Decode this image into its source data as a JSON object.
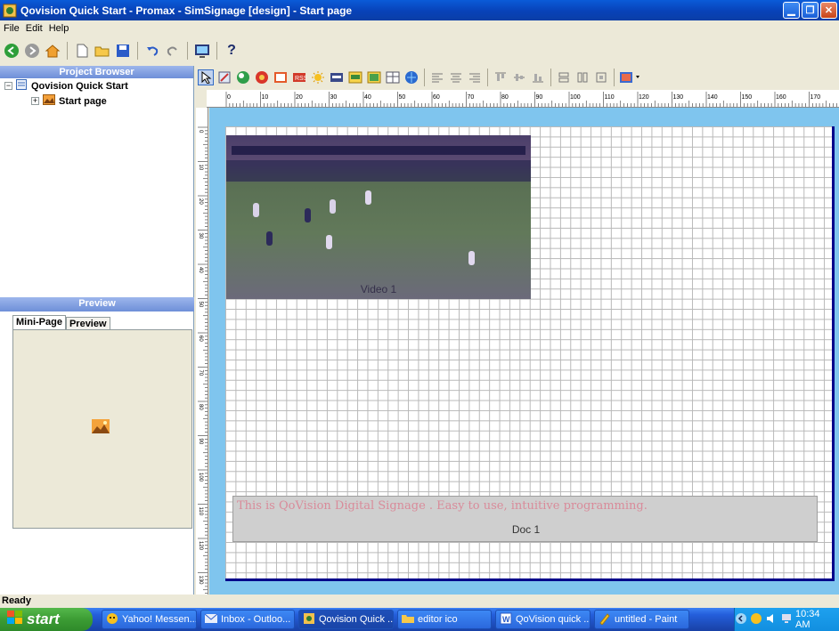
{
  "window": {
    "title": "Qovision Quick Start - Promax - SimSignage [design] - Start page"
  },
  "menu": [
    "File",
    "Edit",
    "Help"
  ],
  "project_browser": {
    "title": "Project Browser",
    "root": "Qovision Quick Start",
    "child": "Start page"
  },
  "preview_panel": {
    "title": "Preview",
    "tabs": [
      "Mini-Page",
      "Preview"
    ]
  },
  "canvas": {
    "ruler_marks": [
      "0",
      "10",
      "20",
      "30",
      "40",
      "50",
      "60",
      "70",
      "80",
      "90",
      "100",
      "110",
      "120",
      "130",
      "140",
      "150",
      "160",
      "170",
      "180"
    ],
    "vruler_marks": [
      "0",
      "10",
      "20",
      "30",
      "40",
      "50",
      "60",
      "70",
      "80",
      "90",
      "100",
      "110",
      "120",
      "130",
      "140"
    ],
    "video_label": "Video 1",
    "doc_text": "This is QoVision Digital Signage . Easy to use, intuitive programming.",
    "doc_label": "Doc 1"
  },
  "status": {
    "text": "Ready"
  },
  "taskbar": {
    "start_label": "start",
    "tasks": [
      "Yahoo! Messen...",
      "Inbox - Outloo...",
      "Qovision Quick ...",
      "editor ico",
      "QoVision quick ...",
      "untitled - Paint"
    ],
    "clock": "10:34 AM"
  },
  "colors": {
    "canvas_frame": "#7fc5ee",
    "canvas_border": "#00008b",
    "titlebar": "#0842b8"
  }
}
